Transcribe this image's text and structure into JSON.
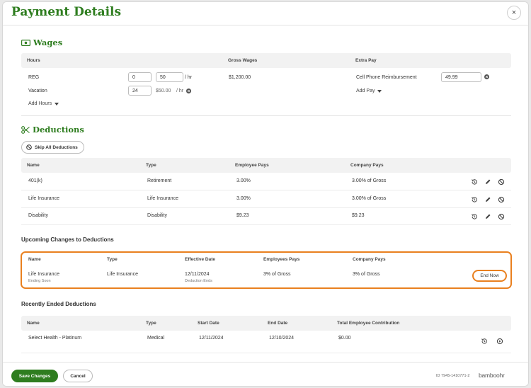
{
  "header": {
    "title": "Payment Details",
    "close_label": "×"
  },
  "wages": {
    "title": "Wages",
    "columns": {
      "hours": "Hours",
      "gross": "Gross Wages",
      "extra": "Extra Pay"
    },
    "reg": {
      "label": "REG",
      "hours_value": "0",
      "rate_value": "50",
      "rate_unit": "/ hr",
      "gross": "$1,200.00"
    },
    "vacation": {
      "label": "Vacation",
      "hours_value": "24",
      "rate_text": "$50.00",
      "rate_unit": "/ hr"
    },
    "add_hours": "Add Hours",
    "extra_pay": {
      "label": "Cell Phone Reimbursement",
      "value": "49.99"
    },
    "add_pay": "Add Pay"
  },
  "deductions": {
    "title": "Deductions",
    "skip_all": "Skip All Deductions",
    "columns": {
      "name": "Name",
      "type": "Type",
      "employee": "Employee Pays",
      "company": "Company Pays"
    },
    "rows": [
      {
        "name": "401(k)",
        "type": "Retirement",
        "employee": "3.00%",
        "company": "3.00% of Gross"
      },
      {
        "name": "Life Insurance",
        "type": "Life Insurance",
        "employee": "3.00%",
        "company": "3.00% of Gross"
      },
      {
        "name": "Disability",
        "type": "Disability",
        "employee": "$9.23",
        "company": "$9.23"
      }
    ]
  },
  "upcoming": {
    "title": "Upcoming Changes to Deductions",
    "columns": {
      "name": "Name",
      "type": "Type",
      "effective": "Effective Date",
      "employees": "Employees Pays",
      "company": "Company Pays"
    },
    "row": {
      "name": "Life Insurance",
      "name_sub": "Ending Soon",
      "type": "Life Insurance",
      "effective": "12/11/2024",
      "effective_sub": "Deduction Ends",
      "employees": "3% of Gross",
      "company": "3% of Gross"
    },
    "end_now": "End Now"
  },
  "ended": {
    "title": "Recently Ended Deductions",
    "columns": {
      "name": "Name",
      "type": "Type",
      "start": "Start Date",
      "end": "End Date",
      "total": "Total Employee Contribution"
    },
    "row": {
      "name": "Select Health - Platinum",
      "type": "Medical",
      "start": "12/11/2024",
      "end": "12/10/2024",
      "total": "$0.00"
    }
  },
  "footer": {
    "save": "Save Changes",
    "cancel": "Cancel",
    "id": "ID 7945-1410771-2",
    "logo": "bamboohr"
  },
  "colors": {
    "brand_green": "#2e7d1f",
    "highlight_orange": "#e9801f"
  }
}
